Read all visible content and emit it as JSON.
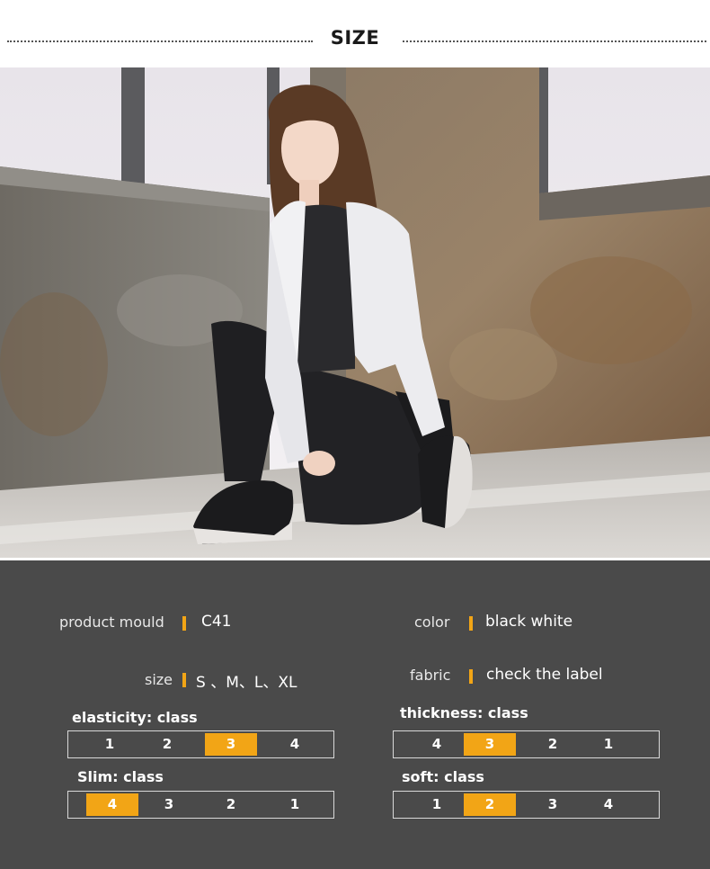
{
  "header": {
    "title": "SIZE"
  },
  "specs": {
    "product_mould": {
      "label": "product mould",
      "value": "C41"
    },
    "color": {
      "label": "color",
      "value": "black white"
    },
    "size": {
      "label": "size",
      "value": "S 、M、L、XL"
    },
    "fabric": {
      "label": "fabric",
      "value": "check the label"
    }
  },
  "ratings": {
    "elasticity": {
      "title": "elasticity:  class",
      "cells": [
        "1",
        "2",
        "3",
        "4"
      ],
      "selected": "3"
    },
    "thickness": {
      "title": "thickness:  class",
      "cells": [
        "4",
        "3",
        "2",
        "1"
      ],
      "selected": "3"
    },
    "slim": {
      "title": "Slim:  class",
      "cells": [
        "4",
        "3",
        "2",
        "1"
      ],
      "selected": "4"
    },
    "soft": {
      "title": "soft:  class",
      "cells": [
        "1",
        "2",
        "3",
        "4"
      ],
      "selected": "2"
    }
  },
  "colors": {
    "accent": "#f2a516",
    "panel": "#4a4a4a"
  }
}
